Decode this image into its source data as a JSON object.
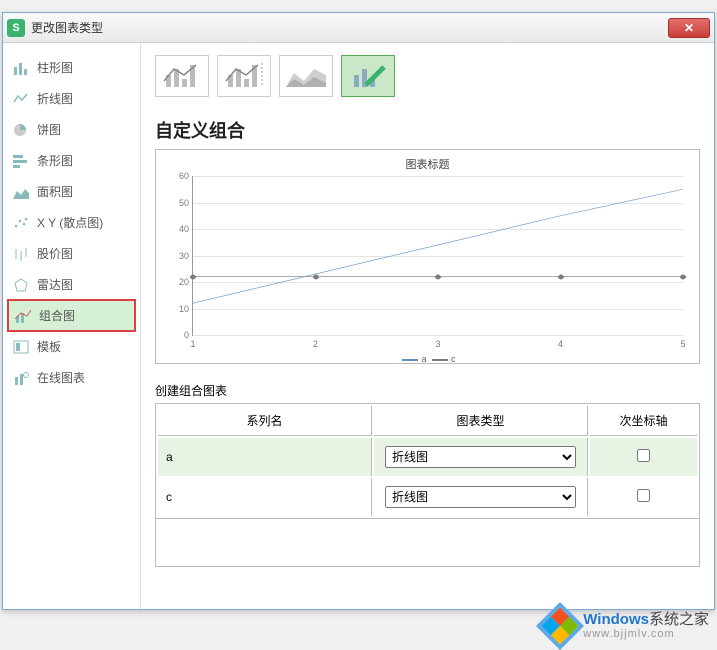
{
  "window": {
    "title": "更改图表类型",
    "app_char": "S"
  },
  "sidebar": {
    "items": [
      {
        "label": "柱形图",
        "icon": "column-chart-icon"
      },
      {
        "label": "折线图",
        "icon": "line-chart-icon"
      },
      {
        "label": "饼图",
        "icon": "pie-chart-icon"
      },
      {
        "label": "条形图",
        "icon": "bar-chart-icon"
      },
      {
        "label": "面积图",
        "icon": "area-chart-icon"
      },
      {
        "label": "X Y (散点图)",
        "icon": "scatter-chart-icon"
      },
      {
        "label": "股价图",
        "icon": "stock-chart-icon"
      },
      {
        "label": "雷达图",
        "icon": "radar-chart-icon"
      },
      {
        "label": "组合图",
        "icon": "combo-chart-icon"
      },
      {
        "label": "模板",
        "icon": "template-icon"
      },
      {
        "label": "在线图表",
        "icon": "online-chart-icon"
      }
    ],
    "selected_index": 8
  },
  "content": {
    "section_title": "自定义组合",
    "build_combo_label": "创建组合图表",
    "table_headers": {
      "series": "系列名",
      "type": "图表类型",
      "secondary": "次坐标轴"
    },
    "rows": [
      {
        "series": "a",
        "type": "折线图",
        "secondary": false
      },
      {
        "series": "c",
        "type": "折线图",
        "secondary": false
      }
    ],
    "type_options": [
      "折线图"
    ]
  },
  "chart_data": {
    "type": "line",
    "title": "图表标题",
    "xlabel": "",
    "ylabel": "",
    "ylim": [
      0,
      60
    ],
    "yticks": [
      0,
      10,
      20,
      30,
      40,
      50,
      60
    ],
    "x": [
      1,
      2,
      3,
      4,
      5
    ],
    "series": [
      {
        "name": "a",
        "values": [
          12,
          23,
          34,
          45,
          55
        ],
        "color": "#5b8fc6"
      },
      {
        "name": "c",
        "values": [
          22,
          22,
          22,
          22,
          22
        ],
        "color": "#7b7b7b"
      }
    ],
    "legend_position": "bottom"
  },
  "watermark": {
    "brand": "Windows",
    "suffix": "系统之家",
    "url": "www.bjjmlv.com"
  }
}
